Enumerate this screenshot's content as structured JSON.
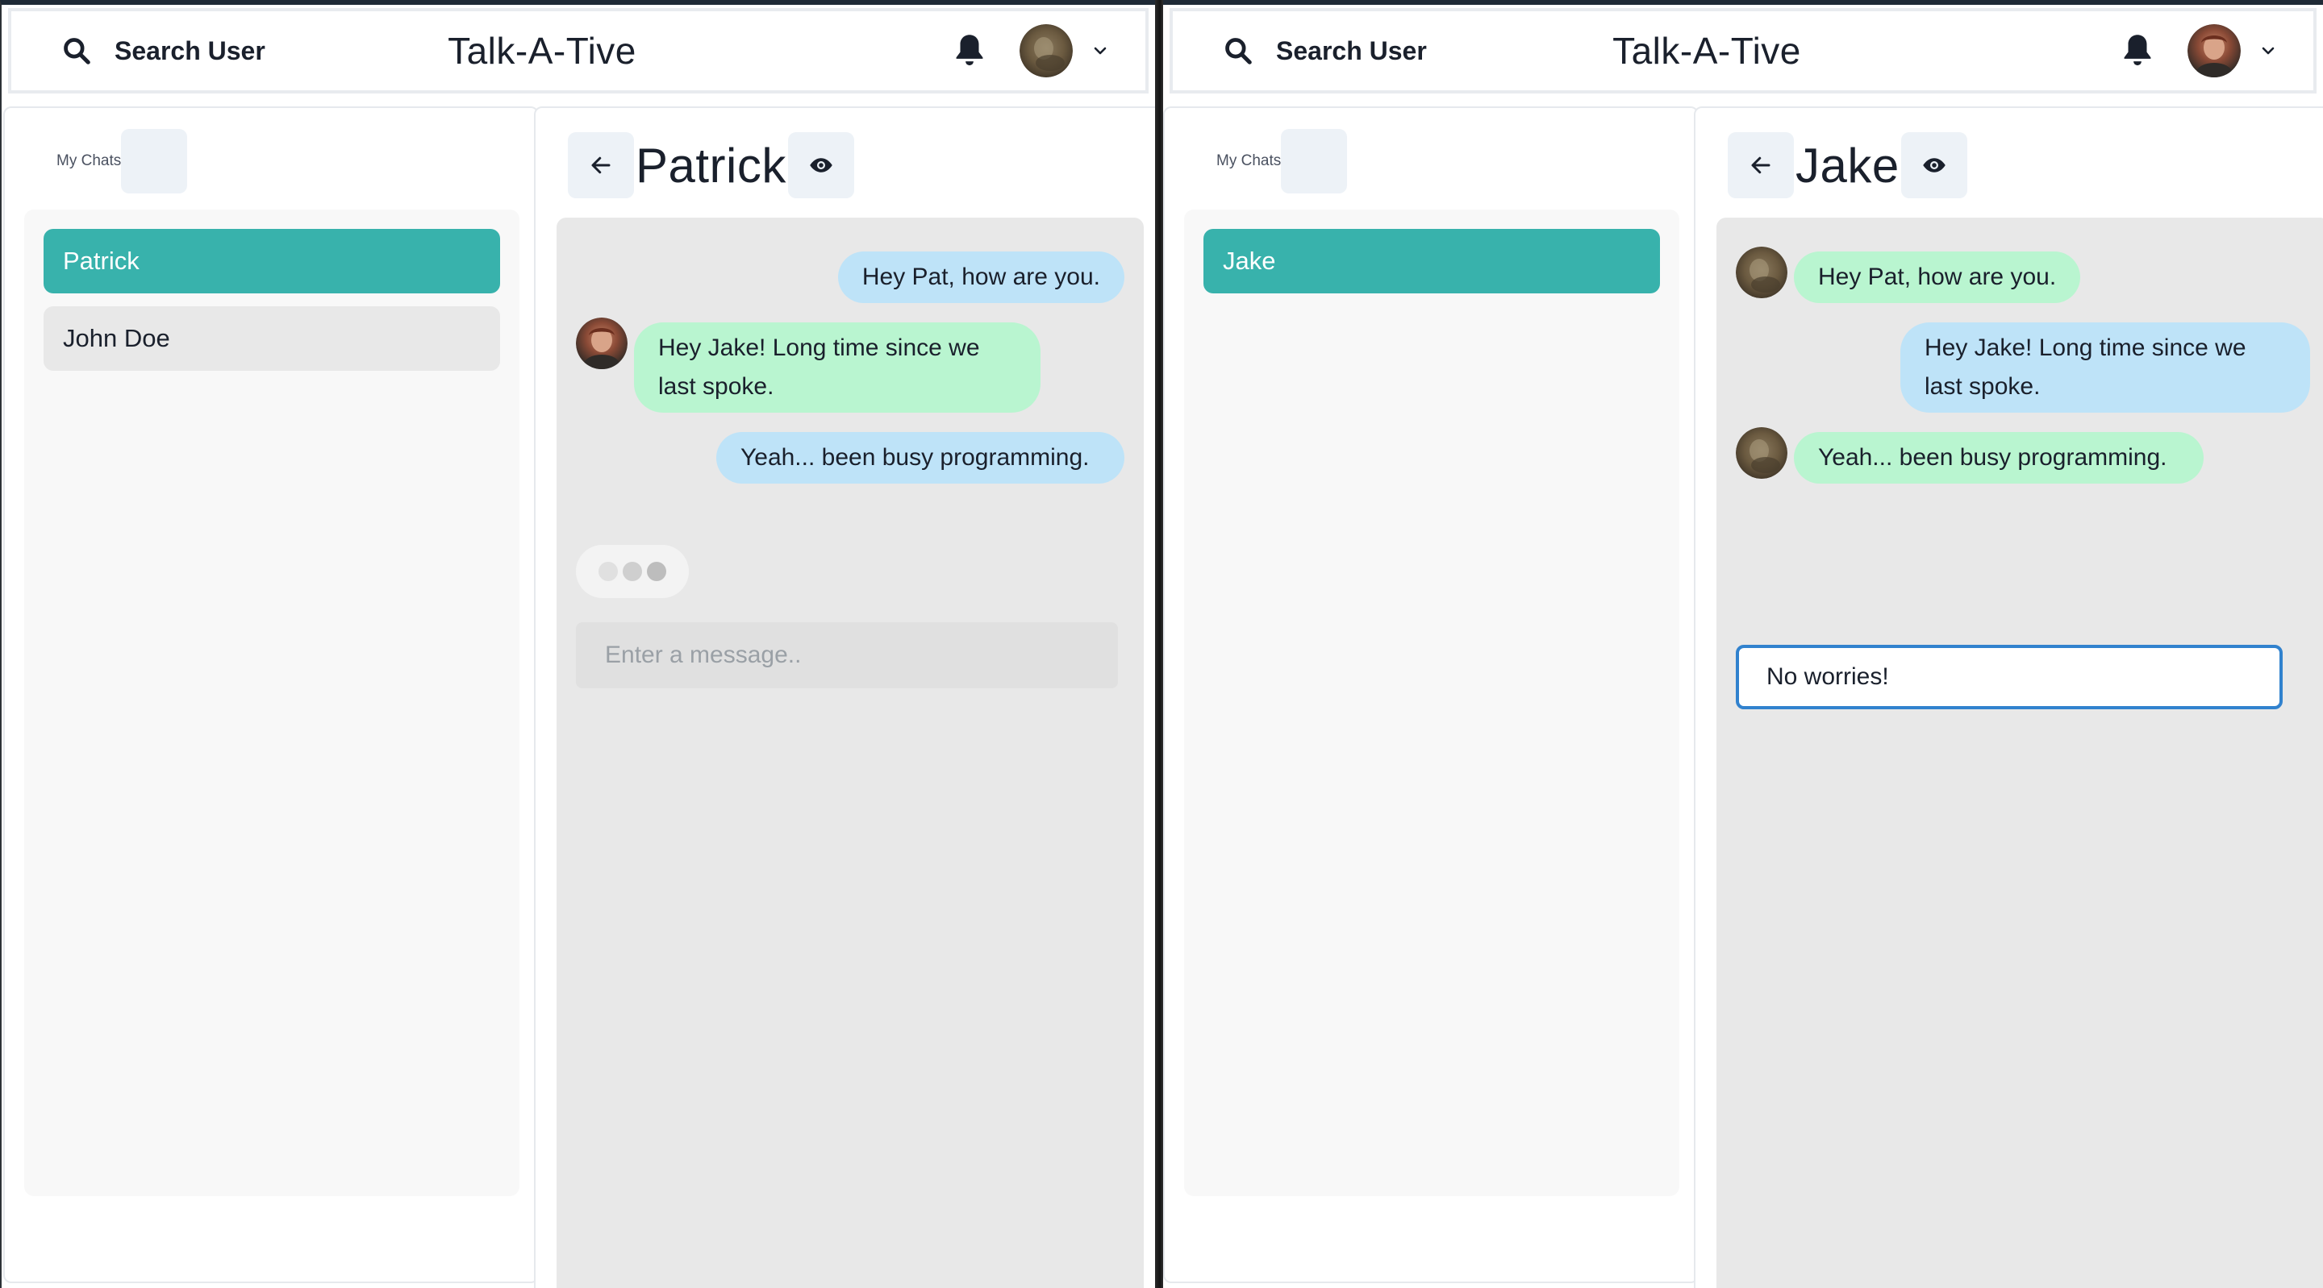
{
  "left": {
    "header": {
      "search_label": "Search User",
      "title": "Talk-A-Tive"
    },
    "my_chats": {
      "title": "My Chats",
      "items": [
        {
          "name": "Patrick",
          "active": true
        },
        {
          "name": "John Doe",
          "active": false
        }
      ]
    },
    "chat": {
      "name": "Patrick",
      "messages": [
        {
          "text": "Hey Pat, how are you.",
          "from": "self"
        },
        {
          "text": "Hey Jake! Long time since we last spoke.",
          "from": "other"
        },
        {
          "text": "Yeah... been busy programming.",
          "from": "self"
        }
      ],
      "typing_indicator": true,
      "input_placeholder": "Enter a message..",
      "input_value": ""
    }
  },
  "right": {
    "header": {
      "search_label": "Search User",
      "title": "Talk-A-Tive"
    },
    "my_chats": {
      "title": "My Chats",
      "items": [
        {
          "name": "Jake",
          "active": true
        }
      ]
    },
    "chat": {
      "name": "Jake",
      "messages": [
        {
          "text": "Hey Pat, how are you.",
          "from": "other"
        },
        {
          "text": "Hey Jake! Long time since we last spoke.",
          "from": "self"
        },
        {
          "text": "Yeah... been busy programming.",
          "from": "other"
        }
      ],
      "input_value": "No worries!"
    }
  },
  "icons": {
    "search": "search-icon",
    "bell": "bell-icon",
    "chevron": "chevron-down-icon",
    "back": "arrow-left-icon",
    "eye": "eye-icon"
  },
  "colors": {
    "accent": "#38b2ac",
    "sent_bubble": "#bee3f8",
    "received_bubble": "#b9f5d0",
    "input_focus": "#3182ce"
  }
}
